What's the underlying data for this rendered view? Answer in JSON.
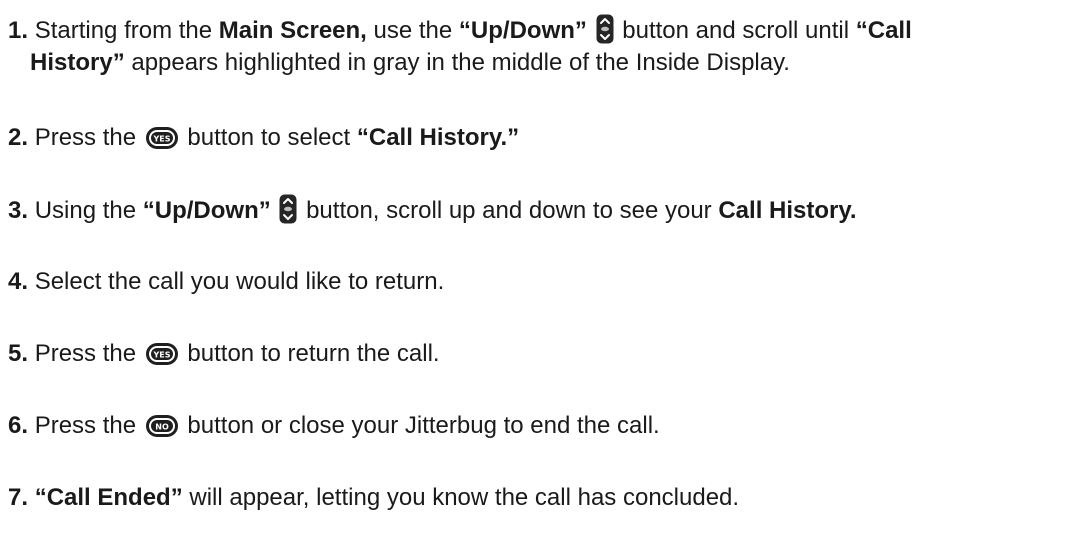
{
  "steps": [
    {
      "number": "1.",
      "t1": "Starting from the",
      "b1": "Main Screen,",
      "t2": "use the",
      "b2": "“Up/Down”",
      "t3": "button and scroll until",
      "b3": "“Call",
      "b4": "History”",
      "t4": "appears highlighted in gray in the middle of the Inside Display."
    },
    {
      "number": "2.",
      "t1": "Press the",
      "t2": "button to select",
      "b1": "“Call History.”"
    },
    {
      "number": "3.",
      "t1": "Using the",
      "b1": "“Up/Down”",
      "t2": "button, scroll up and down to see your",
      "b2": "Call History."
    },
    {
      "number": "4.",
      "t1": "Select the call you would like to return."
    },
    {
      "number": "5.",
      "t1": "Press the",
      "t2": "button to return the call."
    },
    {
      "number": "6.",
      "t1": "Press the",
      "t2": "button or close your Jitterbug to end the call."
    },
    {
      "number": "7.",
      "b1": "“Call Ended”",
      "t1": "will appear, letting you know the call has concluded."
    }
  ],
  "icons": {
    "yes_label": "YES",
    "no_label": "NO",
    "updown": "up-down-icon"
  }
}
